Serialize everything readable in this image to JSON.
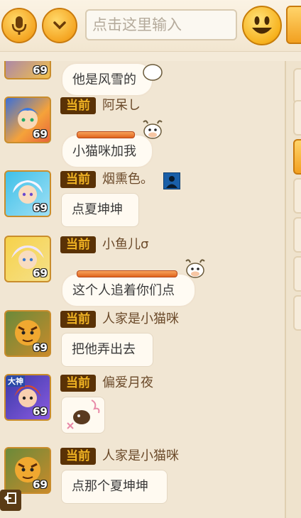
{
  "toolbar": {
    "search_placeholder": "点击这里输入"
  },
  "messages": [
    {
      "text": "他是风雪的",
      "level": "69"
    },
    {
      "tag": "当前",
      "name": "阿呆し",
      "level": "69",
      "text": "小猫咪加我"
    },
    {
      "tag": "当前",
      "name": "烟熏色。",
      "level": "69",
      "text": "点夏坤坤"
    },
    {
      "tag": "当前",
      "name": "小鱼儿σ",
      "level": "69",
      "text": "这个人追着你们点"
    },
    {
      "tag": "当前",
      "name": "人家是小猫咪",
      "level": "69",
      "text": "把他弄出去"
    },
    {
      "tag": "当前",
      "name": "偏爱月夜",
      "level": "69",
      "badge": "大神"
    },
    {
      "tag": "当前",
      "name": "人家是小猫咪",
      "level": "69",
      "text": "点那个夏坤坤"
    }
  ]
}
